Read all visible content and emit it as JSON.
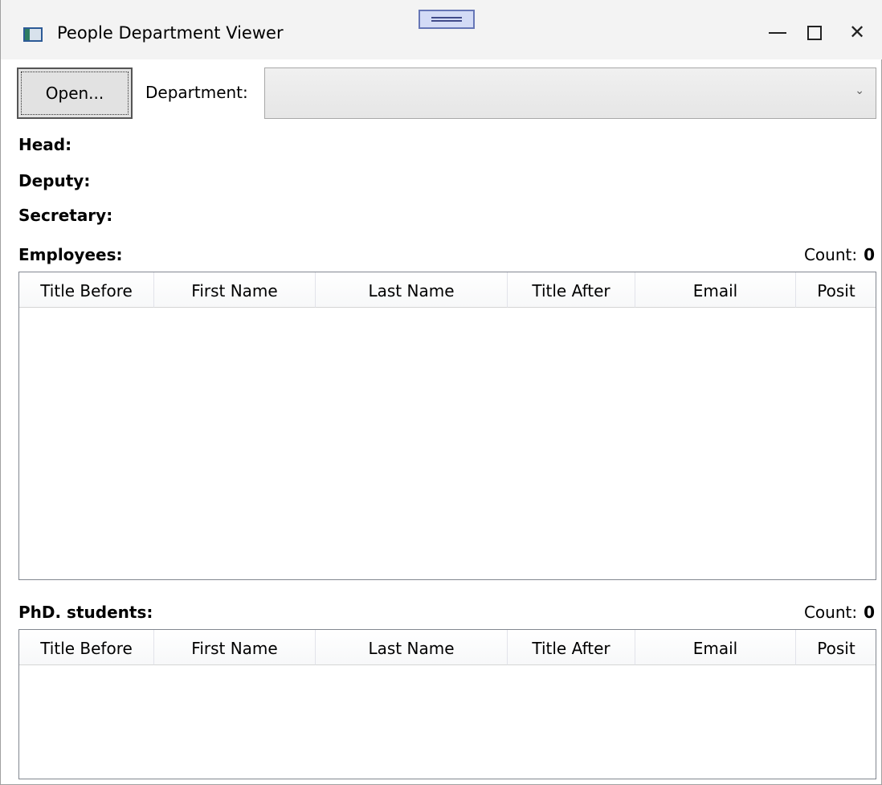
{
  "window": {
    "title": "People Department Viewer"
  },
  "toolbar": {
    "open_label": "Open...",
    "department_label": "Department:",
    "department_value": ""
  },
  "info": {
    "head_label": "Head:",
    "deputy_label": "Deputy:",
    "secretary_label": "Secretary:"
  },
  "employees": {
    "label": "Employees:",
    "count_label": "Count:",
    "count_value": "0",
    "columns": [
      "Title Before",
      "First Name",
      "Last Name",
      "Title After",
      "Email",
      "Posit"
    ],
    "rows": []
  },
  "phd_students": {
    "label": "PhD. students:",
    "count_label": "Count:",
    "count_value": "0",
    "columns": [
      "Title Before",
      "First Name",
      "Last Name",
      "Title After",
      "Email",
      "Posit"
    ],
    "rows": []
  },
  "icons": {
    "app": "app-window-icon",
    "minimize": "minimize-icon",
    "maximize": "maximize-icon",
    "close": "close-icon",
    "dropdown": "chevron-down-icon"
  }
}
